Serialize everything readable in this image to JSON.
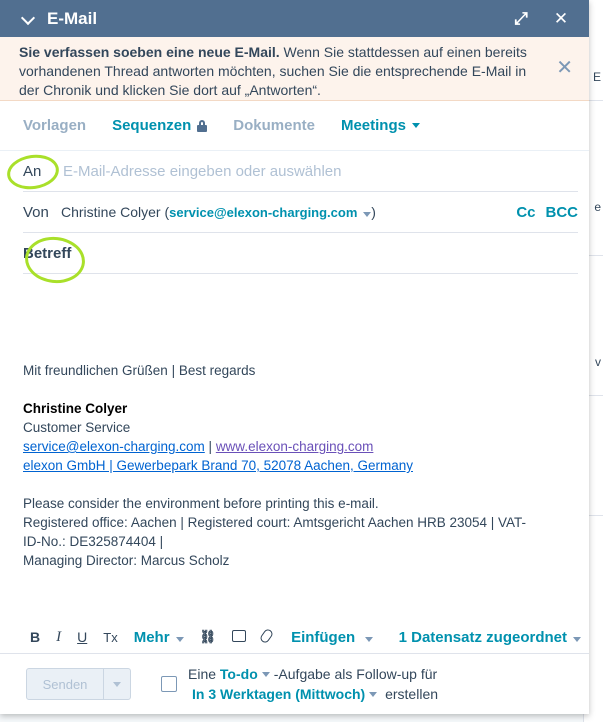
{
  "header": {
    "title": "E-Mail",
    "expand_icon": "expand-arrows-icon",
    "close_icon": "close-icon"
  },
  "notice": {
    "bold": "Sie verfassen soeben eine neue E-Mail.",
    "text": " Wenn Sie stattdessen auf einen bereits vorhandenen Thread antworten möchten, suchen Sie die entsprechende E-Mail in der Chronik und klicken Sie dort auf „Antworten“."
  },
  "tabs": {
    "templates": "Vorlagen",
    "sequences": "Sequenzen",
    "documents": "Dokumente",
    "meetings": "Meetings"
  },
  "to": {
    "label": "An",
    "placeholder": "E-Mail-Adresse eingeben oder auswählen"
  },
  "from": {
    "label": "Von",
    "name": "Christine Colyer",
    "email": "service@elexon-charging.com",
    "cc": "Cc",
    "bcc": "BCC"
  },
  "subject": {
    "label": "Betreff"
  },
  "signature": {
    "greeting": "Mit freundlichen Grüßen | Best regards",
    "name": "Christine Colyer",
    "role": "Customer Service",
    "email_link": "service@elexon-charging.com",
    "separator": " | ",
    "web_link": "www.elexon-charging.com",
    "address_link": "elexon GmbH | Gewerbepark Brand 70, 52078 Aachen, Germany",
    "env": "Please consider the environment before printing this e-mail.",
    "registered": "Registered office: Aachen | Registered court: Amtsgericht Aachen HRB 23054 | VAT-ID-No.: DE325874404 |",
    "director": "Managing Director: Marcus Scholz"
  },
  "toolbar": {
    "bold": "B",
    "italic": "I",
    "underline": "U",
    "clear": "Tx",
    "more": "Mehr",
    "insert": "Einfügen",
    "record": "1 Datensatz zugeordnet"
  },
  "footer": {
    "send": "Senden",
    "followup_pre": "Eine ",
    "todo": "To-do",
    "followup_mid": "-Aufgabe als Follow-up für",
    "days": "In 3 Werktagen (Mittwoch)",
    "followup_post": " erstellen"
  },
  "background": {
    "tick1": "E",
    "tick2": "e",
    "tick3": "v"
  }
}
